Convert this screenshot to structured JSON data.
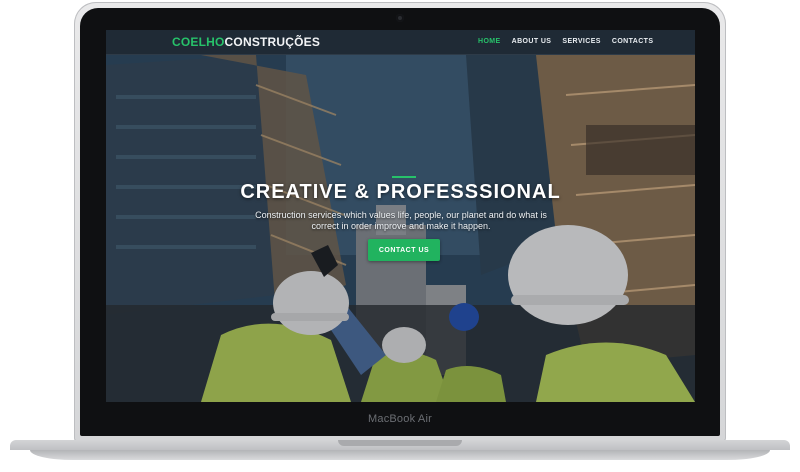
{
  "device": {
    "model": "MacBook Air"
  },
  "site": {
    "brand_primary": "COELHO",
    "brand_secondary": "CONSTRUÇÕES",
    "nav": [
      {
        "label": "HOME",
        "active": true
      },
      {
        "label": "ABOUT US",
        "active": false
      },
      {
        "label": "SERVICES",
        "active": false
      },
      {
        "label": "CONTACTS",
        "active": false
      }
    ]
  },
  "hero": {
    "title": "CREATIVE & PROFESSSIONAL",
    "subtitle": "Construction services which values life, people, our planet and do what is correct in order improve and make it happen.",
    "cta_label": "CONTACT US"
  },
  "colors": {
    "accent": "#27c26a",
    "navbar_bg": "#1f2a35",
    "cta_bg": "#21b35f"
  }
}
